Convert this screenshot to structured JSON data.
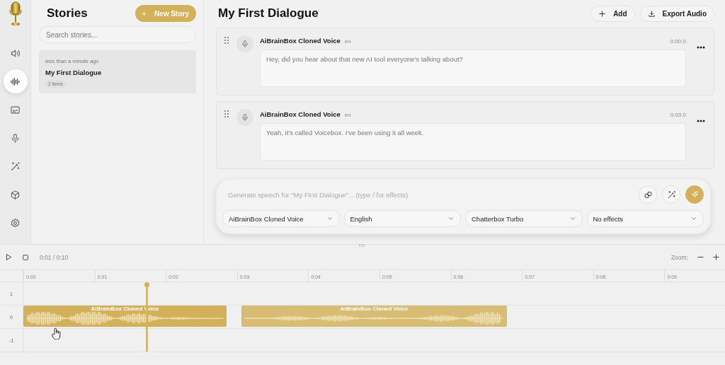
{
  "rail": {
    "items": [
      {
        "selected": false
      },
      {
        "selected": true
      },
      {
        "selected": false
      },
      {
        "selected": false
      },
      {
        "selected": false
      },
      {
        "selected": false
      },
      {
        "selected": false
      }
    ]
  },
  "stories": {
    "title": "Stories",
    "new_button": "New Story",
    "search": {
      "placeholder": "Search stories..."
    },
    "items": [
      {
        "time": "less than a minute ago",
        "title": "My First Dialogue",
        "count": "2 items",
        "selected": true
      }
    ]
  },
  "editor": {
    "title": "My First Dialogue",
    "actions": [
      "Add",
      "Export Audio"
    ],
    "items": [
      {
        "voice": "AiBrainBox Cloned Voice",
        "language": "en",
        "time": "0:00.0",
        "text": "Hey, did you hear about that new AI tool everyone's talking about?"
      },
      {
        "voice": "AiBrainBox Cloned Voice",
        "language": "en",
        "time": "0:03.0",
        "text": "Yeah, it's called Voicebox. I've been using it all week."
      }
    ]
  },
  "composer": {
    "placeholder": "Generate speech for \"My First Dialogue\"... (type / for effects)",
    "selects": [
      "AiBrainBox Cloned Voice",
      "English",
      "Chatterbox Turbo",
      "No effects"
    ]
  },
  "timeline": {
    "time": "0:01 / 0:10",
    "zoom_label": "Zoom:",
    "ticks": [
      "0:00",
      "0:01",
      "0:02",
      "0:03",
      "0:04",
      "0:05",
      "0:06",
      "0:07",
      "0:08",
      "0:09"
    ],
    "tracks": [
      {
        "label": "1"
      },
      {
        "label": "0",
        "clips": [
          {
            "label": "AiBrainBox Cloned Voice"
          },
          {
            "label": "AiBrainBox Cloned Voice"
          }
        ]
      },
      {
        "label": "-1"
      }
    ],
    "playhead": {
      "level": 0.173
    }
  }
}
